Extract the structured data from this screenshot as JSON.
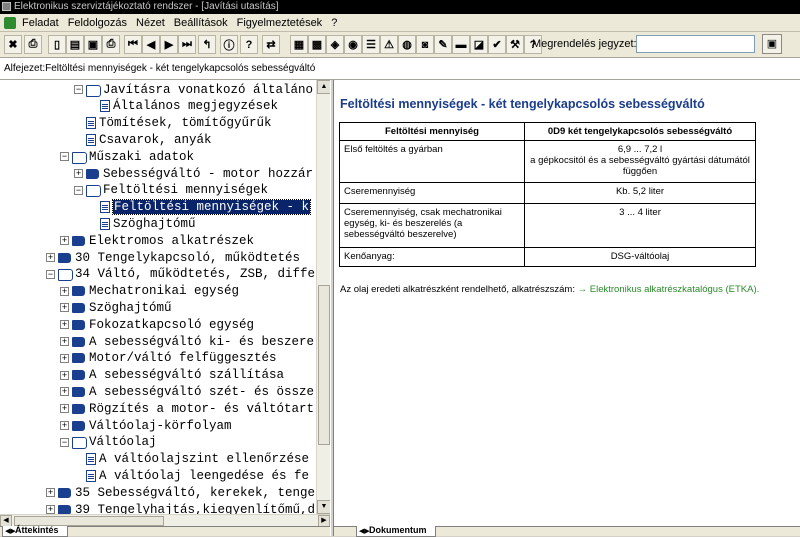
{
  "window": {
    "title": "Elektronikus szerviztájékoztató rendszer - [Javítási utasítás]"
  },
  "menu": [
    "Feladat",
    "Feldolgozás",
    "Nézet",
    "Beállítások",
    "Figyelmeztetések",
    "?"
  ],
  "toolbar": {
    "buttons": [
      {
        "name": "exit-icon",
        "glyph": "✖"
      },
      {
        "name": "print-icon",
        "glyph": "⎙"
      },
      {
        "name": "document-icon",
        "glyph": "▯"
      },
      {
        "name": "page-icon",
        "glyph": "▤"
      },
      {
        "name": "car-icon",
        "glyph": "▣"
      },
      {
        "name": "printer2-icon",
        "glyph": "⎙"
      },
      {
        "name": "first-icon",
        "glyph": "⏮"
      },
      {
        "name": "prev-icon",
        "glyph": "◀"
      },
      {
        "name": "next-icon",
        "glyph": "▶"
      },
      {
        "name": "last-icon",
        "glyph": "⏭"
      },
      {
        "name": "back-icon",
        "glyph": "↰"
      },
      {
        "name": "info-icon",
        "glyph": "ⓘ"
      },
      {
        "name": "help-icon",
        "glyph": "?"
      },
      {
        "name": "switch-icon",
        "glyph": "⇄"
      },
      {
        "name": "catalog-icon",
        "glyph": "▦"
      },
      {
        "name": "grid-icon",
        "glyph": "▩"
      },
      {
        "name": "parts-icon",
        "glyph": "◈"
      },
      {
        "name": "wheel-icon",
        "glyph": "◉"
      },
      {
        "name": "list-icon",
        "glyph": "☰"
      },
      {
        "name": "warning-icon",
        "glyph": "⚠"
      },
      {
        "name": "globe-icon",
        "glyph": "◍"
      },
      {
        "name": "bucket-icon",
        "glyph": "◙"
      },
      {
        "name": "pen-icon",
        "glyph": "✎"
      },
      {
        "name": "car2-icon",
        "glyph": "▬"
      },
      {
        "name": "diagnose-icon",
        "glyph": "◪"
      },
      {
        "name": "check-icon",
        "glyph": "✔"
      },
      {
        "name": "tools-icon",
        "glyph": "⚒"
      },
      {
        "name": "question-icon",
        "glyph": "?"
      }
    ],
    "order_label": "Megrendelés jegyzet:",
    "order_value": "",
    "order_button_glyph": "▣"
  },
  "breadcrumb": "Alfejezet:Feltöltési mennyiségek - két tengelykapcsolós sebességváltó",
  "tree": [
    {
      "level": 3,
      "exp": "-",
      "icon": "book-open",
      "label": "Javításra vonatkozó általáno"
    },
    {
      "level": 4,
      "exp": "",
      "icon": "doc",
      "label": "Általános megjegyzések"
    },
    {
      "level": 3,
      "exp": "",
      "icon": "doc",
      "label": "Tömítések, tömítőgyűrűk"
    },
    {
      "level": 3,
      "exp": "",
      "icon": "doc",
      "label": "Csavarok, anyák"
    },
    {
      "level": 2,
      "exp": "-",
      "icon": "book-open",
      "label": "Műszaki adatok"
    },
    {
      "level": 3,
      "exp": "+",
      "icon": "book",
      "label": "Sebességváltó - motor hozzár"
    },
    {
      "level": 3,
      "exp": "-",
      "icon": "book-open",
      "label": "Feltöltési mennyiségek"
    },
    {
      "level": 4,
      "exp": "",
      "icon": "doc",
      "label": "Feltöltési mennyiségek - k",
      "selected": true
    },
    {
      "level": 4,
      "exp": "",
      "icon": "doc",
      "label": "Szöghajtómű"
    },
    {
      "level": 2,
      "exp": "+",
      "icon": "book",
      "label": "Elektromos alkatrészek"
    },
    {
      "level": 1,
      "exp": "+",
      "icon": "book",
      "label": "30 Tengelykapcsoló, működtetés"
    },
    {
      "level": 1,
      "exp": "-",
      "icon": "book-open",
      "label": "34 Váltó, működtetés, ZSB, diffe"
    },
    {
      "level": 2,
      "exp": "+",
      "icon": "book",
      "label": "Mechatronikai egység"
    },
    {
      "level": 2,
      "exp": "+",
      "icon": "book",
      "label": "Szöghajtómű"
    },
    {
      "level": 2,
      "exp": "+",
      "icon": "book",
      "label": "Fokozatkapcsoló egység"
    },
    {
      "level": 2,
      "exp": "+",
      "icon": "book",
      "label": "A sebességváltó ki- és beszere"
    },
    {
      "level": 2,
      "exp": "+",
      "icon": "book",
      "label": "Motor/váltó felfüggesztés"
    },
    {
      "level": 2,
      "exp": "+",
      "icon": "book",
      "label": "A sebességváltó szállítása"
    },
    {
      "level": 2,
      "exp": "+",
      "icon": "book",
      "label": "A sebességváltó szét- és össze"
    },
    {
      "level": 2,
      "exp": "+",
      "icon": "book",
      "label": "Rögzítés a motor- és váltótart"
    },
    {
      "level": 2,
      "exp": "+",
      "icon": "book",
      "label": "Váltóolaj-körfolyam"
    },
    {
      "level": 2,
      "exp": "-",
      "icon": "book-open",
      "label": "Váltóolaj"
    },
    {
      "level": 3,
      "exp": "",
      "icon": "doc",
      "label": "A váltóolajszint ellenőrzése"
    },
    {
      "level": 3,
      "exp": "",
      "icon": "doc",
      "label": "A váltóolaj leengedése és fe"
    },
    {
      "level": 1,
      "exp": "+",
      "icon": "book",
      "label": "35 Sebességváltó, kerekek, tenge"
    },
    {
      "level": 1,
      "exp": "+",
      "icon": "book",
      "label": "39 Tengelyhajtás,kiegyenlítőmű,d"
    }
  ],
  "tabs": {
    "left": "Áttekintés",
    "right": "Dokumentum"
  },
  "document": {
    "title": "Feltöltési mennyiségek - két tengelykapcsolós sebességváltó",
    "table": {
      "headers": [
        "Feltöltési mennyiség",
        "0D9 két tengelykapcsolós sebességváltó"
      ],
      "rows": [
        [
          "Első feltöltés a gyárban",
          "6,9 ... 7,2 l\na gépkocsitól és a sebességváltó gyártási dátumától függően"
        ],
        [
          "Cseremennyiség",
          "Kb. 5,2 liter"
        ],
        [
          "Cseremennyiség, csak mechatronikai egység, ki- és beszerelés (a sebességváltó beszerelve)",
          "3 ... 4 liter"
        ],
        [
          "Kenőanyag:",
          "DSG-váltóolaj"
        ]
      ]
    },
    "note_text": "Az olaj eredeti alkatrészként rendelhető, alkatrészszám:",
    "note_link": "→ Elektronikus alkatrészkatalógus (ETKA)."
  }
}
